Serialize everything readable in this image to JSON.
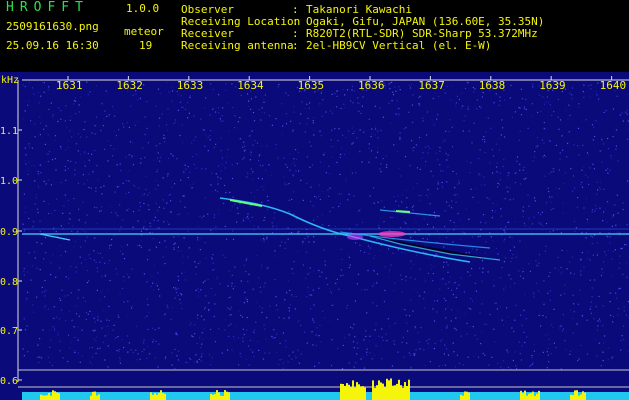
{
  "header": {
    "app_title": "HROFFT",
    "app_version": "1.0.0",
    "filename": "2509161630.png",
    "datetime": "25.09.16 16:30",
    "meteor_label": "meteor",
    "meteor_count": "19",
    "info": [
      {
        "label": "Observer",
        "value": "Takanori Kawachi"
      },
      {
        "label": "Receiving Location",
        "value": "Ogaki, Gifu, JAPAN (136.60E, 35.35N)"
      },
      {
        "label": "Receiver",
        "value": "R820T2(RTL-SDR) SDR-Sharp 53.372MHz"
      },
      {
        "label": "Receiving antenna",
        "value": "2el-HB9CV Vertical (el. E-W)"
      }
    ]
  },
  "spectrogram": {
    "y_unit": "kHz",
    "x_ticks": [
      "1631",
      "1632",
      "1633",
      "1634",
      "1635",
      "1636",
      "1637",
      "1638",
      "1639",
      "1640"
    ],
    "y_ticks": [
      "1.1",
      "1.0",
      "0.9",
      "0.8",
      "0.7",
      "0.6"
    ],
    "colors": {
      "background": "#0a0a7a",
      "noise": "#3a3ad0",
      "carrier": "#4ad0ff",
      "signal": "#40ff80",
      "activity": "#f5f50a",
      "baseline": "#20c8f0",
      "guide": "#c8c8c8"
    }
  },
  "chart_data": {
    "type": "heatmap",
    "x_label_ticks": [
      1631,
      1632,
      1633,
      1634,
      1635,
      1636,
      1637,
      1638,
      1639,
      1640
    ],
    "y_label": "kHz",
    "y_ticks": [
      1.1,
      1.0,
      0.9,
      0.8,
      0.7,
      0.6
    ],
    "carrier_khz": 0.89
  }
}
